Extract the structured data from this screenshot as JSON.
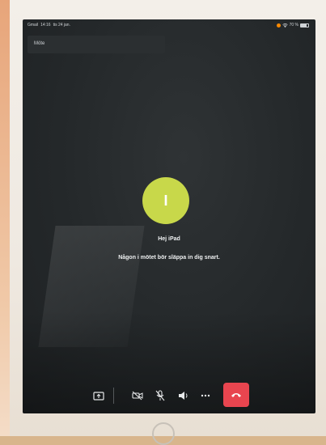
{
  "status": {
    "left": [
      "Gmail",
      "14:16",
      "tis 24 jan."
    ],
    "right": "70 %"
  },
  "titlebar": {
    "title": "Möte"
  },
  "call": {
    "avatar_initial": "I",
    "greeting": "Hej iPad",
    "message": "Någon i mötet bör släppa in dig snart."
  },
  "icons": {
    "share": "screen-share-icon",
    "camera_off": "video-off-icon",
    "mic_off": "mic-off-icon",
    "speaker": "speaker-icon",
    "more": "more-icon",
    "hangup": "phone-hangup-icon"
  },
  "colors": {
    "avatar": "#c8d84a",
    "hangup": "#e8454f",
    "background": "#24282a"
  }
}
